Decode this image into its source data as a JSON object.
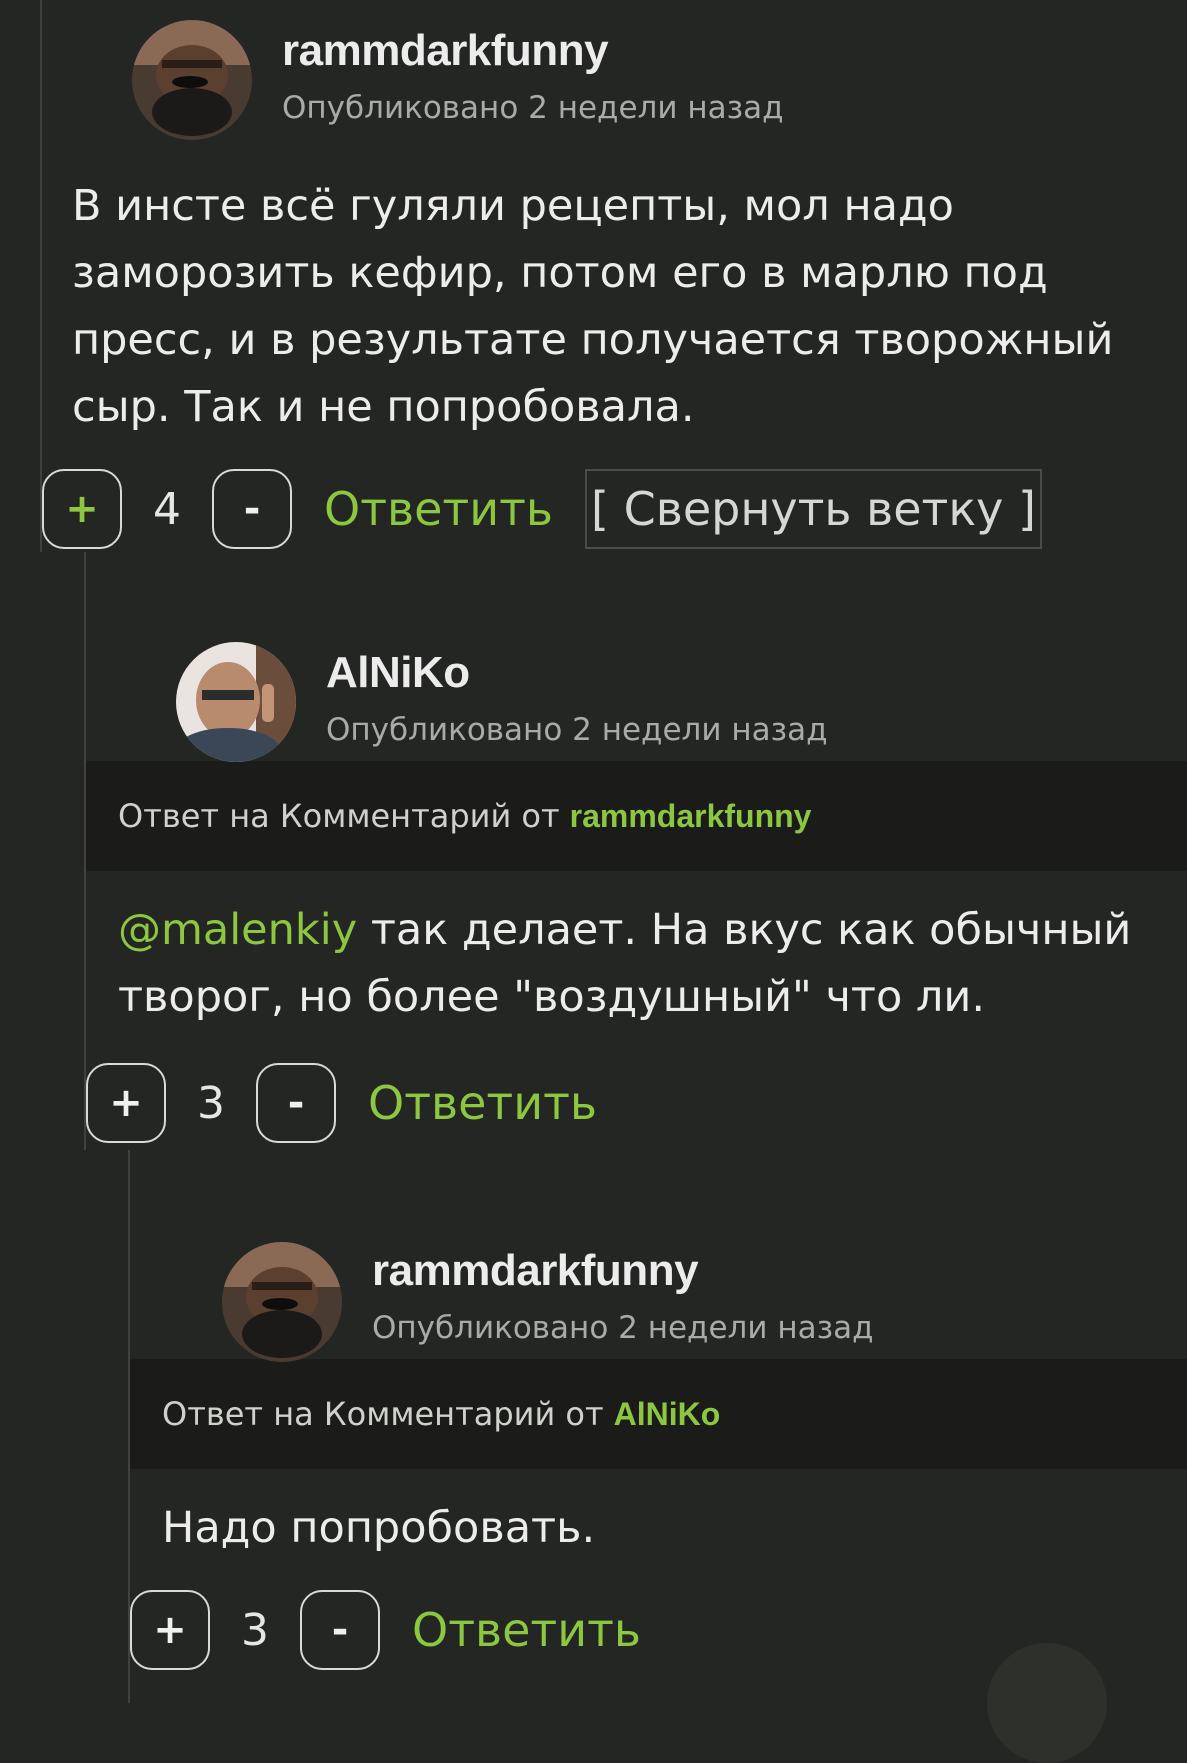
{
  "comments": [
    {
      "username": "rammdarkfunny",
      "meta": "Опубликовано 2 недели назад",
      "text": "В инсте всё гуляли рецепты, мол надо заморозить кефир, потом его в марлю под пресс, и в результате получается творожный сыр. Так и не попробовала.",
      "score": "4",
      "plus": "+",
      "minus": "-",
      "reply_label": "Ответить",
      "collapse_label": "[ Свернуть ветку ]"
    },
    {
      "username": "AlNiKo",
      "meta": "Опубликовано 2 недели назад",
      "reply_to_prefix": "Ответ на Комментарий от",
      "reply_to_user": "rammdarkfunny",
      "mention": "@malenkiy",
      "text": " так делает. На вкус как обычный творог, но более \"воздушный\" что ли.",
      "score": "3",
      "plus": "+",
      "minus": "-",
      "reply_label": "Ответить"
    },
    {
      "username": "rammdarkfunny",
      "meta": "Опубликовано 2 недели назад",
      "reply_to_prefix": "Ответ на Комментарий от",
      "reply_to_user": "AlNiKo",
      "text": "Надо попробовать.",
      "score": "3",
      "plus": "+",
      "minus": "-",
      "reply_label": "Ответить"
    }
  ]
}
